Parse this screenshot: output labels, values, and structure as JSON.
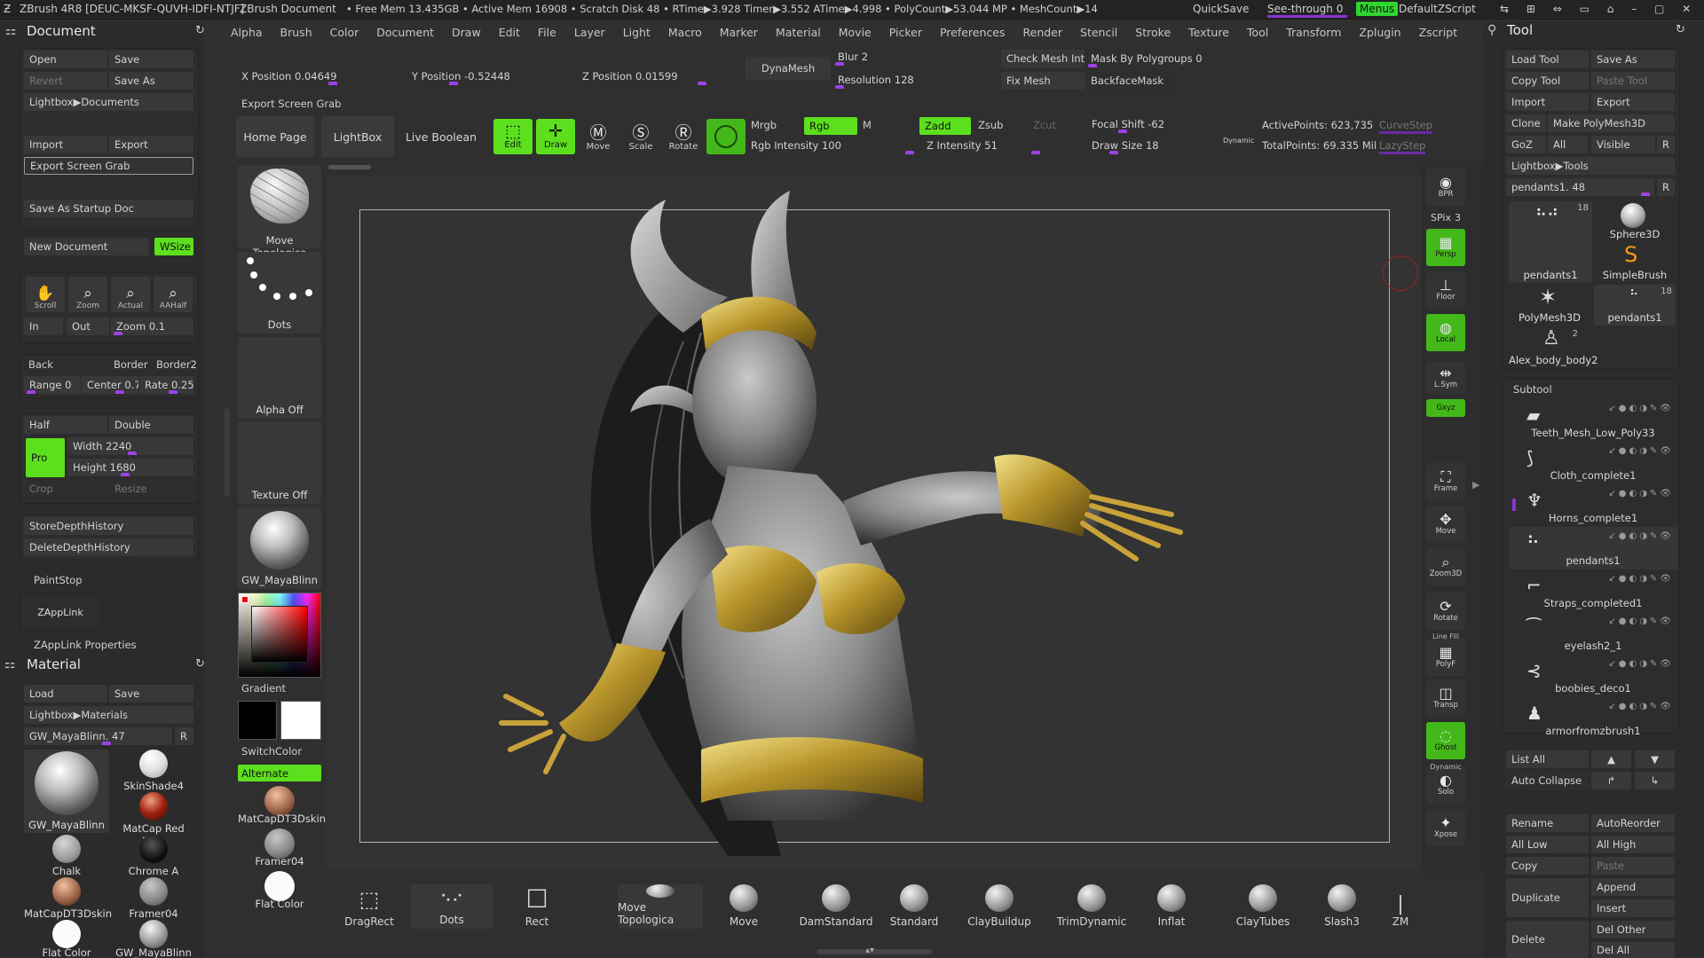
{
  "title": {
    "app": "ZBrush 4R8 [DEUC-MKSF-QUVH-IDFI-NTJF]",
    "doc": "ZBrush Document",
    "stats": "• Free Mem 13.435GB • Active Mem 16908 • Scratch Disk 48 • RTime▶3.928 Timer▶3.552 ATime▶4.998 • PolyCount▶53.044 MP • MeshCount▶14",
    "quicksave": "QuickSave",
    "seethrough": "See-through",
    "seethrough_value": "0",
    "menus": "Menus",
    "script": "DefaultZScript"
  },
  "menubar": [
    "Alpha",
    "Brush",
    "Color",
    "Document",
    "Draw",
    "Edit",
    "File",
    "Layer",
    "Light",
    "Macro",
    "Marker",
    "Material",
    "Movie",
    "Picker",
    "Preferences",
    "Render",
    "Stencil",
    "Stroke",
    "Texture",
    "Tool",
    "Transform",
    "Zplugin",
    "Zscript"
  ],
  "document": {
    "title": "Document",
    "open": "Open",
    "save": "Save",
    "revert": "Revert",
    "save_as": "Save As",
    "lightbox": "Lightbox▶Documents",
    "import": "Import",
    "export": "Export",
    "export_screen_grab": "Export Screen Grab",
    "save_startup": "Save As Startup Doc",
    "new_document": "New Document",
    "wsize": "WSize",
    "scroll": "Scroll",
    "zoom": "Zoom",
    "actual": "Actual",
    "aahalf": "AAHalf",
    "in": "In",
    "out": "Out",
    "zoom_label": "Zoom",
    "zoom_value": "0.1",
    "back": "Back",
    "border": "Border",
    "border2": "Border2",
    "range_label": "Range",
    "range_value": "0",
    "center_label": "Center",
    "center_value": "0.7",
    "rate_label": "Rate",
    "rate_value": "0.25",
    "half": "Half",
    "double": "Double",
    "pro": "Pro",
    "width_label": "Width",
    "width_value": "2240",
    "height_label": "Height",
    "height_value": "1680",
    "crop": "Crop",
    "resize": "Resize",
    "store_depth": "StoreDepthHistory",
    "delete_depth": "DeleteDepthHistory",
    "paintstop": "PaintStop",
    "zapplink": "ZAppLink",
    "zapplink_props": "ZAppLink Properties"
  },
  "material": {
    "title": "Material",
    "load": "Load",
    "save": "Save",
    "lightbox": "Lightbox▶Materials",
    "current": "GW_MayaBlinn. 47",
    "r": "R",
    "items": [
      "GW_MayaBlinn",
      "SkinShade4",
      "MatCap Red Wax",
      "Chalk",
      "Chrome A",
      "MatCapDT3Dskin",
      "Framer04",
      "Flat Color",
      "GW_MayaBlinn"
    ]
  },
  "shelf_left": {
    "brush": "Move Topologica",
    "stroke": "Dots",
    "alpha": "Alpha Off",
    "texture": "Texture Off",
    "material": "GW_MayaBlinn",
    "gradient": "Gradient",
    "switchcolor": "SwitchColor",
    "alternate": "Alternate",
    "mat2": "MatCapDT3Dskin",
    "mat3": "Framer04",
    "mat4": "Flat Color"
  },
  "topshelf": {
    "x_label": "X Position",
    "x_value": "0.04649",
    "y_label": "Y Position",
    "y_value": "-0.52448",
    "z_label": "Z Position",
    "z_value": "0.01599",
    "dynamesh": "DynaMesh",
    "blur_label": "Blur",
    "blur_value": "2",
    "resolution_label": "Resolution",
    "resolution_value": "128",
    "check_mesh": "Check Mesh Int",
    "fix_mesh": "Fix Mesh",
    "mask_polygroups": "Mask By Polygroups",
    "mask_value": "0",
    "backface": "BackfaceMask",
    "export_grab": "Export Screen Grab",
    "home": "Home Page",
    "lightbox": "LightBox",
    "live_boolean": "Live Boolean",
    "edit": "Edit",
    "draw": "Draw",
    "move": "Move",
    "scale": "Scale",
    "rotate": "Rotate",
    "mrgb": "Mrgb",
    "rgb": "Rgb",
    "m": "M",
    "zadd": "Zadd",
    "zsub": "Zsub",
    "zcut": "Zcut",
    "rgb_intensity_label": "Rgb Intensity",
    "rgb_intensity_value": "100",
    "z_intensity_label": "Z Intensity",
    "z_intensity_value": "51",
    "focal_label": "Focal Shift",
    "focal_value": "-62",
    "drawsize_label": "Draw Size",
    "drawsize_value": "18",
    "dynamic": "Dynamic",
    "active_points": "ActivePoints: 623,735",
    "total_points": "TotalPoints: 69.335 Mil",
    "curvestep": "CurveStep",
    "lazystep": "LazyStep"
  },
  "rightshelf": [
    "BPR",
    "SPix",
    "Persp",
    "Floor",
    "Local",
    "L.Sym",
    "Gxyz",
    "Frame",
    "Move",
    "Zoom3D",
    "Rotate",
    "PolyF",
    "Transp",
    "Ghost",
    "Solo",
    "Xpose"
  ],
  "rightshelf_extra": {
    "spix_value": "3",
    "dynamic": "Dynamic",
    "linefill": "Line Fill"
  },
  "brushes_bottom": [
    "DragRect",
    "Dots",
    "Rect",
    "Move Topologica",
    "Move",
    "DamStandard",
    "Standard",
    "ClayBuildup",
    "TrimDynamic",
    "Inflat",
    "ClayTubes",
    "Slash3",
    "ZM"
  ],
  "tool": {
    "title": "Tool",
    "load": "Load Tool",
    "save_as": "Save As",
    "copy": "Copy Tool",
    "paste": "Paste Tool",
    "import": "Import",
    "export": "Export",
    "clone": "Clone",
    "make_polymesh": "Make PolyMesh3D",
    "goz": "GoZ",
    "all": "All",
    "visible": "Visible",
    "r": "R",
    "lightbox": "Lightbox▶Tools",
    "current": "pendants1. 48",
    "thumbs": [
      {
        "name": "pendants1",
        "count": "18"
      },
      {
        "name": "Sphere3D",
        "count": ""
      },
      {
        "name": "SimpleBrush",
        "count": ""
      },
      {
        "name": "PolyMesh3D",
        "count": ""
      },
      {
        "name": "pendants1",
        "count": "18"
      },
      {
        "name": "Alex_body_body2",
        "count": "2"
      }
    ],
    "subtool_title": "Subtool",
    "subtools": [
      "Teeth_Mesh_Low_Poly33",
      "Cloth_complete1",
      "Horns_complete1",
      "pendants1",
      "Straps_completed1",
      "eyelash2_1",
      "boobies_deco1",
      "armorfromzbrush1"
    ],
    "list_all": "List All",
    "auto_collapse": "Auto Collapse",
    "rename": "Rename",
    "autoreorder": "AutoReorder",
    "all_low": "All Low",
    "all_high": "All High",
    "copy2": "Copy",
    "paste2": "Paste",
    "duplicate": "Duplicate",
    "append": "Append",
    "insert": "Insert",
    "delete": "Delete",
    "del_other": "Del Other",
    "del_all": "Del All"
  }
}
